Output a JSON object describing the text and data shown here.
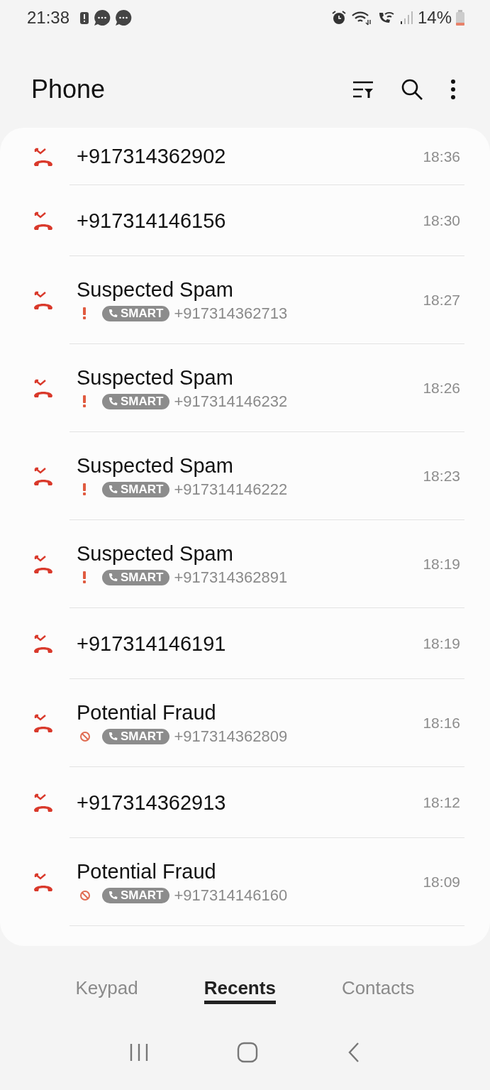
{
  "status_bar": {
    "time": "21:38",
    "battery": "14%"
  },
  "header": {
    "title": "Phone"
  },
  "calls": [
    {
      "kind": "number",
      "title": "+917314362902",
      "time": "18:36"
    },
    {
      "kind": "number",
      "title": "+917314146156",
      "time": "18:30"
    },
    {
      "kind": "labeled",
      "title": "Suspected Spam",
      "flag": {
        "kind": "spam"
      },
      "badge": "SMART",
      "number": "+917314362713",
      "time": "18:27"
    },
    {
      "kind": "labeled",
      "title": "Suspected Spam",
      "flag": {
        "kind": "spam"
      },
      "badge": "SMART",
      "number": "+917314146232",
      "time": "18:26"
    },
    {
      "kind": "labeled",
      "title": "Suspected Spam",
      "flag": {
        "kind": "spam"
      },
      "badge": "SMART",
      "number": "+917314146222",
      "time": "18:23"
    },
    {
      "kind": "labeled",
      "title": "Suspected Spam",
      "flag": {
        "kind": "spam"
      },
      "badge": "SMART",
      "number": "+917314362891",
      "time": "18:19"
    },
    {
      "kind": "number",
      "title": "+917314146191",
      "time": "18:19"
    },
    {
      "kind": "labeled",
      "title": "Potential Fraud",
      "flag": {
        "kind": "fraud"
      },
      "badge": "SMART",
      "number": "+917314362809",
      "time": "18:16"
    },
    {
      "kind": "number",
      "title": "+917314362913",
      "time": "18:12"
    },
    {
      "kind": "labeled",
      "title": "Potential Fraud",
      "flag": {
        "kind": "fraud"
      },
      "badge": "SMART",
      "number": "+917314146160",
      "time": "18:09"
    }
  ],
  "tabs": [
    {
      "label": "Keypad",
      "selected": false
    },
    {
      "label": "Recents",
      "selected": true
    },
    {
      "label": "Contacts",
      "selected": false
    }
  ]
}
